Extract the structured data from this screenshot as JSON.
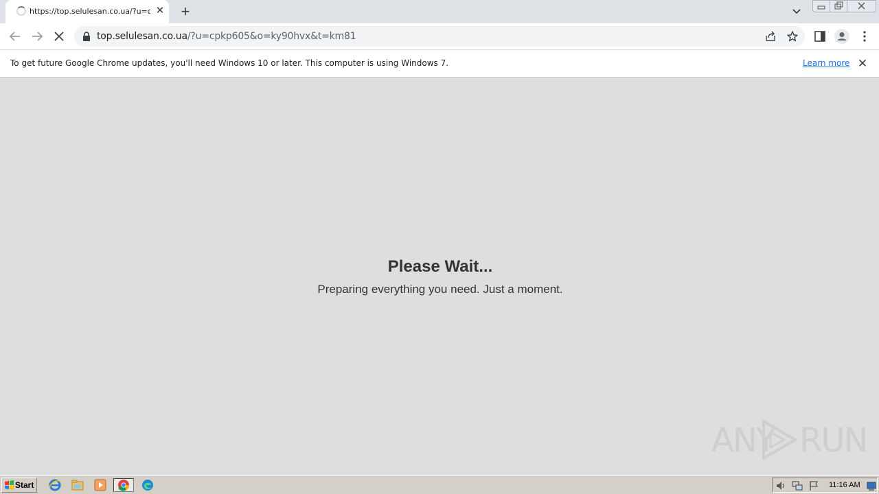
{
  "browser": {
    "tab": {
      "title": "https://top.selulesan.co.ua/?u=cpkp605&o=ky90hvx&t=km81",
      "close_icon": "close-icon",
      "loading": true
    },
    "new_tab_glyph": "+",
    "omnibox": {
      "url_host": "top.selulesan.co.ua",
      "url_path": "/?u=cpkp605&o=ky90hvx&t=km81",
      "secure": true
    },
    "icons": [
      "back-arrow-icon",
      "forward-arrow-icon",
      "stop-loading-icon",
      "lock-icon",
      "share-icon",
      "star-bookmark-icon",
      "side-panel-icon",
      "profile-avatar-icon",
      "more-menu-icon",
      "tab-search-chevron-icon"
    ]
  },
  "infobar": {
    "message": "To get future Google Chrome updates, you'll need Windows 10 or later. This computer is using Windows 7.",
    "link_label": "Learn more",
    "close_glyph": "✕"
  },
  "page": {
    "title": "Please Wait...",
    "subtitle": "Preparing everything you need. Just a moment."
  },
  "watermark": {
    "left_text": "ANY",
    "right_text": "RUN"
  },
  "taskbar": {
    "start_label": "Start",
    "clock": "11:16 AM",
    "apps": [
      "internet-explorer-icon",
      "file-explorer-icon",
      "media-player-icon",
      "chrome-icon",
      "edge-icon"
    ],
    "tray_icons": [
      "volume-icon",
      "network-icon",
      "action-center-flag-icon",
      "show-desktop-icon"
    ]
  },
  "colors": {
    "page_bg": "#dedede",
    "text": "#333333",
    "link": "#1a73e8",
    "tabstrip": "#dee1e6",
    "taskbar": "#d4d0c8"
  }
}
